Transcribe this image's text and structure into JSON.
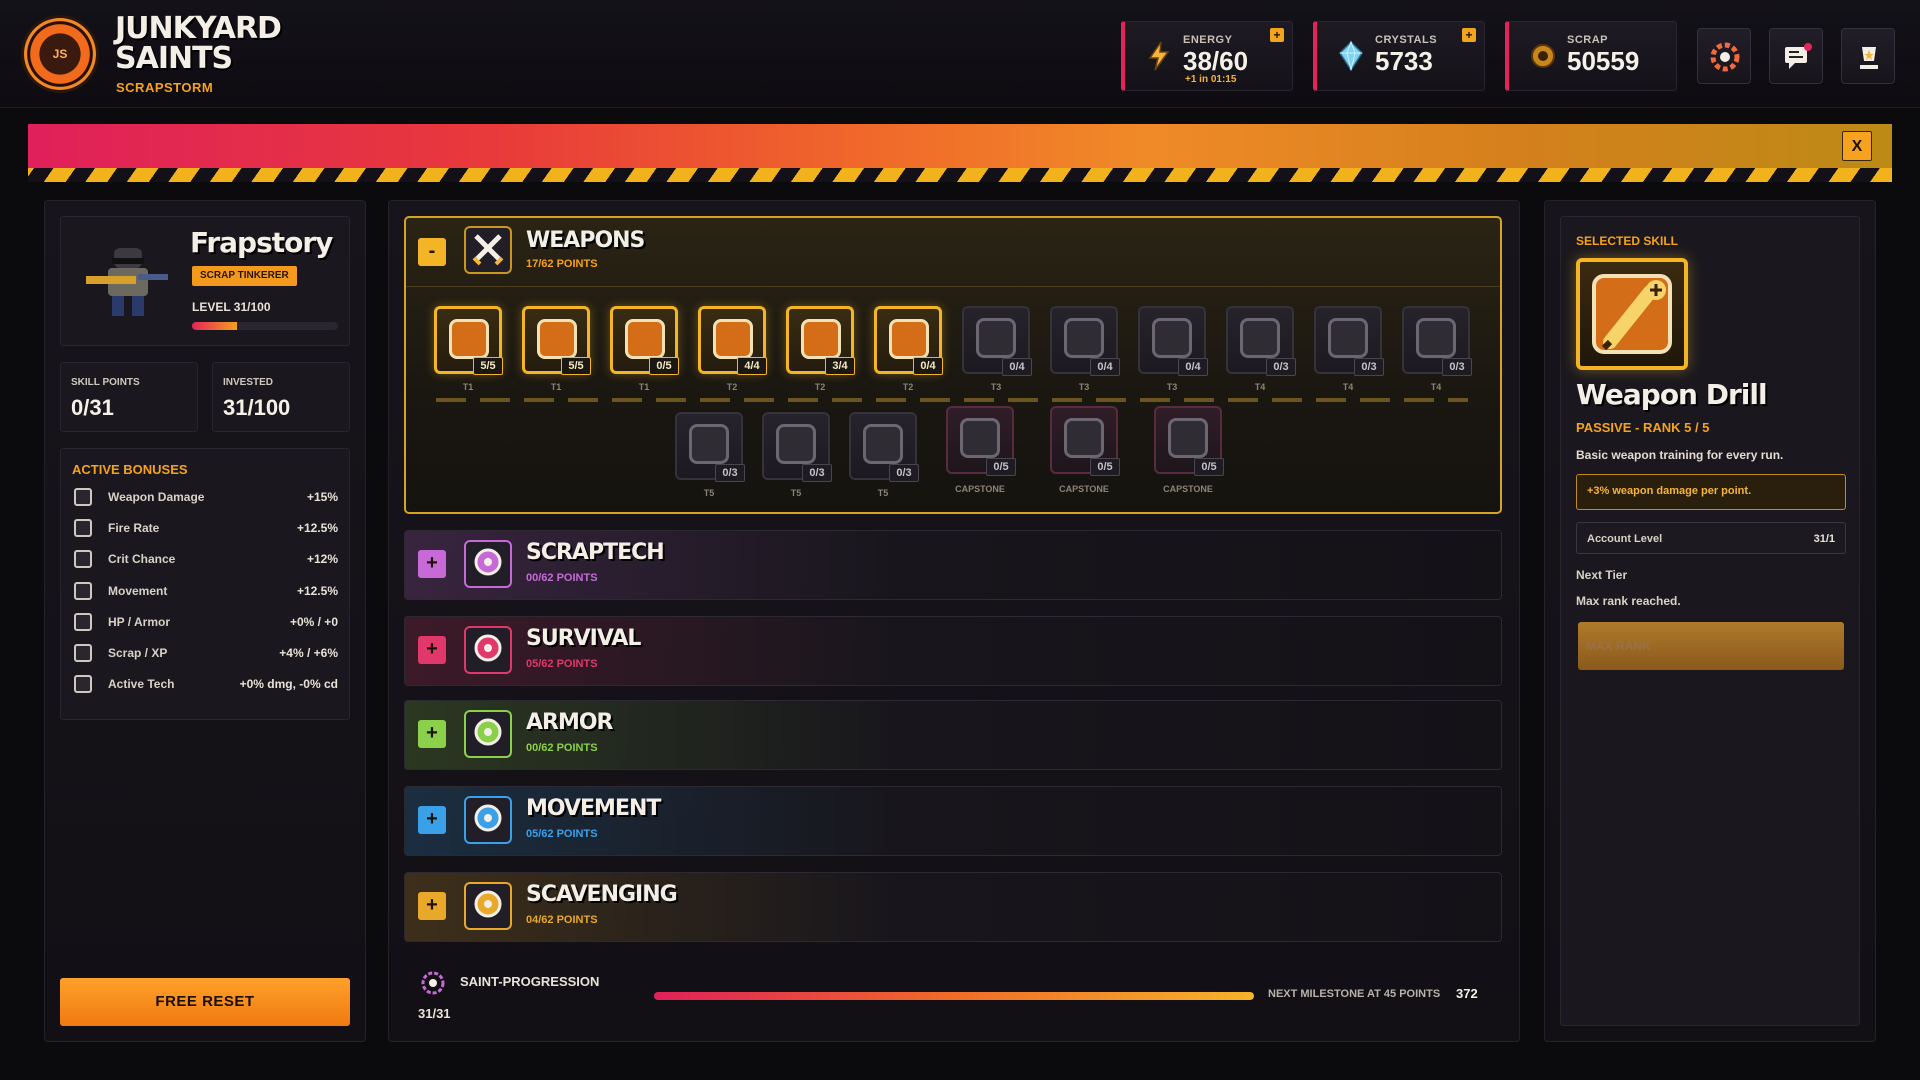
{
  "game": {
    "title": "JUNKYARD SAINTS",
    "logo_badge": "JS",
    "subtitle": "SCRAPSTORM"
  },
  "resources": {
    "energy": {
      "label": "ENERGY",
      "value": "38/60",
      "sub": "+1 in 01:15",
      "icon": "lightning-icon"
    },
    "crystals": {
      "label": "CRYSTALS",
      "value": "5733",
      "icon": "crystal-icon"
    },
    "scrap": {
      "label": "SCRAP",
      "value": "50559",
      "icon": "gear-coin-icon"
    }
  },
  "colors": {
    "accent_orange": "#f6a21c",
    "accent_pink": "#e3245a",
    "gold": "#f3b526"
  },
  "player": {
    "name": "Frapstory",
    "class": "SCRAP TINKERER",
    "level": "LEVEL 31/100",
    "level_fraction": 0.31
  },
  "stats": {
    "skill_points_label": "SKILL POINTS",
    "skill_points": "0/31",
    "invested_label": "INVESTED",
    "invested": "31/100"
  },
  "bonuses": {
    "title": "ACTIVE BONUSES",
    "items": [
      {
        "name": "Weapon Damage",
        "value": "+15%"
      },
      {
        "name": "Fire Rate",
        "value": "+12.5%"
      },
      {
        "name": "Crit Chance",
        "value": "+12%"
      },
      {
        "name": "Movement",
        "value": "+12.5%"
      },
      {
        "name": "HP / Armor",
        "value": "+0% / +0"
      },
      {
        "name": "Scrap / XP",
        "value": "+4% / +6%"
      },
      {
        "name": "Active Tech",
        "value": "+0% dmg, -0% cd"
      }
    ]
  },
  "reset_label": "FREE RESET",
  "weapons": {
    "name": "WEAPONS",
    "points": "17/62 POINTS",
    "toggle": "-",
    "icon_tag": "WEA",
    "row1": [
      {
        "count": "5/5",
        "tier": "T1",
        "state": "active"
      },
      {
        "count": "5/5",
        "tier": "T1",
        "state": "active"
      },
      {
        "count": "0/5",
        "tier": "T1",
        "state": "active"
      },
      {
        "count": "4/4",
        "tier": "T2",
        "state": "active"
      },
      {
        "count": "3/4",
        "tier": "T2",
        "state": "active"
      },
      {
        "count": "0/4",
        "tier": "T2",
        "state": "active"
      },
      {
        "count": "0/4",
        "tier": "T3",
        "state": "dim"
      },
      {
        "count": "0/4",
        "tier": "T3",
        "state": "dim"
      },
      {
        "count": "0/4",
        "tier": "T3",
        "state": "dim"
      },
      {
        "count": "0/3",
        "tier": "T4",
        "state": "dim"
      },
      {
        "count": "0/3",
        "tier": "T4",
        "state": "dim"
      },
      {
        "count": "0/3",
        "tier": "T4",
        "state": "dim"
      }
    ],
    "row2": [
      {
        "count": "0/3",
        "tier": "T5",
        "state": "dim"
      },
      {
        "count": "0/3",
        "tier": "T5",
        "state": "dim"
      },
      {
        "count": "0/3",
        "tier": "T5",
        "state": "dim"
      },
      {
        "count": "0/5",
        "tier": "CAPSTONE",
        "state": "cap"
      },
      {
        "count": "0/5",
        "tier": "CAPSTONE",
        "state": "cap"
      },
      {
        "count": "0/5",
        "tier": "CAPSTONE",
        "state": "cap"
      }
    ]
  },
  "categories": [
    {
      "name": "SCRAPTECH",
      "points": "00/62 POINTS",
      "toggle": "+",
      "color": "#c76ad8",
      "icon_tag": "SCR"
    },
    {
      "name": "SURVIVAL",
      "points": "05/62 POINTS",
      "toggle": "+",
      "color": "#e0386a",
      "icon_tag": "SUR"
    },
    {
      "name": "ARMOR",
      "points": "00/62 POINTS",
      "toggle": "+",
      "color": "#8ad04a",
      "icon_tag": "ARM"
    },
    {
      "name": "MOVEMENT",
      "points": "05/62 POINTS",
      "toggle": "+",
      "color": "#3aa0e8",
      "icon_tag": "MOV"
    },
    {
      "name": "SCAVENGING",
      "points": "04/62 POINTS",
      "toggle": "+",
      "color": "#e8a82a",
      "icon_tag": ""
    }
  ],
  "progression": {
    "label": "SAINT-PROGRESSION",
    "value": "31/31",
    "milestone": "NEXT MILESTONE AT 45 POINTS",
    "milestone_value": "372"
  },
  "selected": {
    "header": "SELECTED SKILL",
    "name": "Weapon Drill",
    "rank": "PASSIVE - RANK 5 / 5",
    "desc": "Basic weapon training for every run.",
    "bonus": "+3% weapon damage per point.",
    "account_label": "Account Level",
    "account_value": "31/1",
    "next_tier_label": "Next Tier",
    "next_tier_text": "Max rank reached.",
    "button": "MAX RANK"
  }
}
